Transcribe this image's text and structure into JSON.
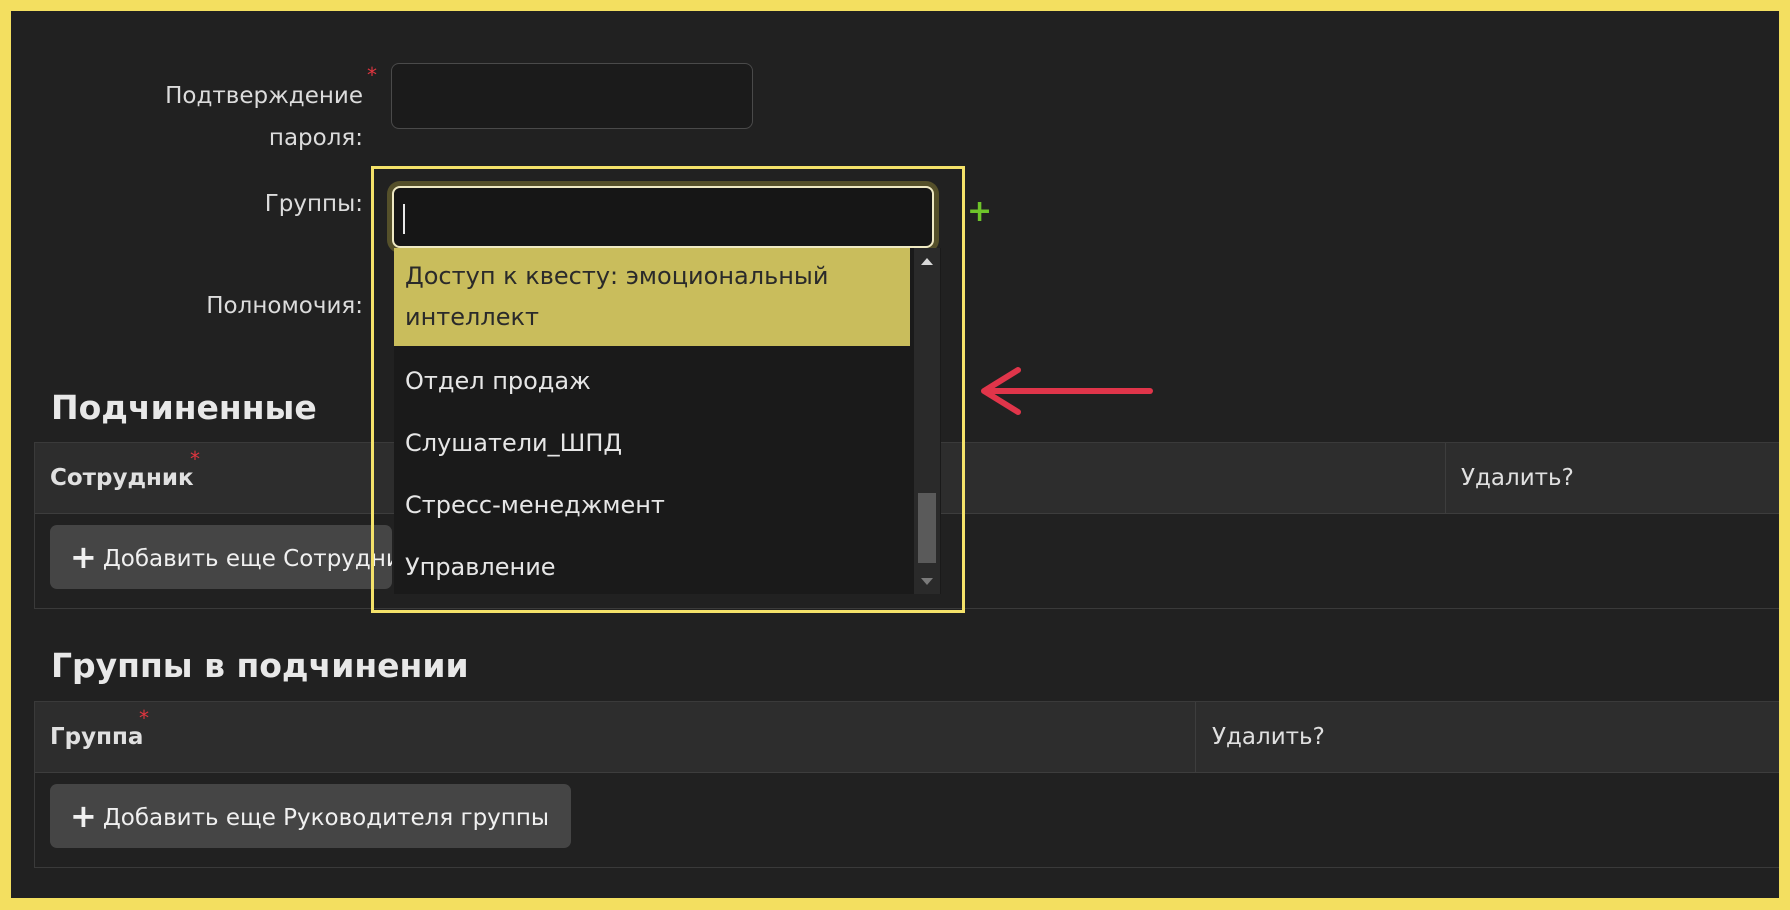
{
  "form": {
    "password_confirm_label_line1": "Подтверждение",
    "password_confirm_label_line2": "пароля:",
    "required_mark": "*",
    "groups_label": "Группы:",
    "permissions_label": "Полномочия:",
    "groups_search_value": "",
    "add_group_symbol": "+"
  },
  "groups_dropdown": {
    "options": [
      {
        "line1": "Доступ к квесту: эмоциональный",
        "line2": "интеллект",
        "selected": true
      },
      {
        "line1": "Отдел продаж"
      },
      {
        "line1": "Слушатели_ШПД"
      },
      {
        "line1": "Стресс-менеджмент"
      },
      {
        "line1": "Управление"
      }
    ]
  },
  "subordinates": {
    "title": "Подчиненные",
    "col_employee": "Сотрудник",
    "col_delete": "Удалить?",
    "add_button": "Добавить еще Сотрудника"
  },
  "subordinate_groups": {
    "title": "Группы в подчинении",
    "col_group": "Группа",
    "col_delete": "Удалить?",
    "add_button": "Добавить еще Руководителя группы"
  },
  "colors": {
    "highlight": "#f4e26a",
    "selected_option": "#c9bd5c",
    "arrow": "#e0354a",
    "required": "#e0353f",
    "add_icon": "#6ec42a"
  }
}
